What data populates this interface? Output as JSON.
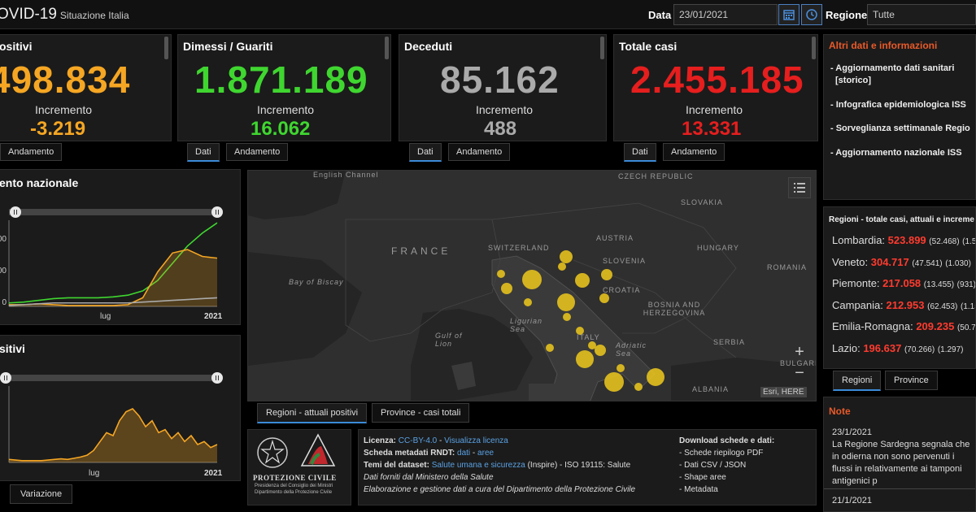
{
  "header": {
    "title": "OVID-19",
    "subtitle": "Situazione Italia",
    "data_label": "Data",
    "data_value": "23/01/2021",
    "regione_label": "Regione",
    "regione_value": "Tutte"
  },
  "colors": {
    "yellow": "#f5a623",
    "green": "#3fd630",
    "gray": "#aaaaaa",
    "red": "#e61e1e",
    "accent": "#3b8bd9"
  },
  "cards": [
    {
      "title": "ositivi",
      "value": "498.834",
      "inc_label": "Incremento",
      "inc_value": "-3.219",
      "tabs": [
        "Andamento"
      ]
    },
    {
      "title": "Dimessi / Guariti",
      "value": "1.871.189",
      "inc_label": "Incremento",
      "inc_value": "16.062",
      "tabs": [
        "Dati",
        "Andamento"
      ]
    },
    {
      "title": "Deceduti",
      "value": "85.162",
      "inc_label": "Incremento",
      "inc_value": "488",
      "tabs": [
        "Dati",
        "Andamento"
      ]
    },
    {
      "title": "Totale casi",
      "value": "2.455.185",
      "inc_label": "Incremento",
      "inc_value": "13.331",
      "tabs": [
        "Dati",
        "Andamento"
      ]
    }
  ],
  "info": {
    "title": "Altri dati e informazioni",
    "items": [
      "- Aggiornamento dati sanitari",
      "[storico]",
      "- Infografica epidemiologica ISS",
      "- Sorveglianza settimanale Regio",
      "- Aggiornamento nazionale ISS"
    ]
  },
  "chart1": {
    "title": "ento nazionale",
    "tick_y": [
      "00",
      "00",
      "0"
    ],
    "tick_x": [
      "lug",
      "2021"
    ]
  },
  "chart2": {
    "title": "sitivi",
    "tick_x": [
      "lug",
      "2021"
    ],
    "tab": "Variazione"
  },
  "chart_data": [
    {
      "type": "line",
      "title": "ento nazionale",
      "x": [
        "lug",
        "2021"
      ],
      "series": [
        {
          "name": "Dimessi / Guariti",
          "color": "#3fd630",
          "values": [
            0.04,
            0.05,
            0.07,
            0.09,
            0.1,
            0.1,
            0.1,
            0.11,
            0.13,
            0.18,
            0.3,
            0.5,
            0.7,
            0.85,
            0.97
          ]
        },
        {
          "name": "Totale positivi",
          "color": "#f5a623",
          "values": [
            0.02,
            0.02,
            0.03,
            0.02,
            0.01,
            0.01,
            0.01,
            0.01,
            0.02,
            0.1,
            0.4,
            0.62,
            0.66,
            0.58,
            0.56
          ]
        },
        {
          "name": "Deceduti",
          "color": "#aaaaaa",
          "values": [
            0.01,
            0.02,
            0.03,
            0.04,
            0.04,
            0.04,
            0.04,
            0.04,
            0.04,
            0.05,
            0.06,
            0.07,
            0.08,
            0.09,
            0.1
          ]
        }
      ]
    },
    {
      "type": "area",
      "title": "sitivi",
      "x": [
        "lug",
        "2021"
      ],
      "series": [
        {
          "name": "Variazione",
          "color": "#f5a623",
          "values": [
            0.05,
            0.04,
            0.03,
            0.03,
            0.03,
            0.03,
            0.04,
            0.05,
            0.06,
            0.05,
            0.07,
            0.09,
            0.12,
            0.2,
            0.35,
            0.5,
            0.45,
            0.7,
            0.85,
            0.9,
            0.78,
            0.6,
            0.7,
            0.5,
            0.55,
            0.4,
            0.5,
            0.35,
            0.45,
            0.3,
            0.35,
            0.25,
            0.3
          ]
        }
      ]
    }
  ],
  "map": {
    "tabs": [
      "Regioni - attuali positivi",
      "Province - casi totali"
    ],
    "labels": [
      "English Channel",
      "FRANCE",
      "SWITZERLAND",
      "AUSTRIA",
      "SLOVENIA",
      "CROATIA",
      "CZECH REPUBLIC",
      "SLOVAKIA",
      "HUNGARY",
      "ROMANIA",
      "BOSNIA AND HERZEGOVINA",
      "SERBIA",
      "BULGARI",
      "ALBANIA",
      "ITALY",
      "Bay of Biscay",
      "Ligurian Sea",
      "Adriatic Sea",
      "Gulf of Lion"
    ],
    "credit": "Esri, HERE"
  },
  "regions": {
    "title": "Regioni - totale casi, attuali e increme",
    "rows": [
      {
        "name": "Lombardia:",
        "val": "523.899",
        "a": "(52.468)",
        "b": "(1.53"
      },
      {
        "name": "Veneto:",
        "val": "304.717",
        "a": "(47.541)",
        "b": "(1.030)"
      },
      {
        "name": "Piemonte:",
        "val": "217.058",
        "a": "(13.455)",
        "b": "(931)"
      },
      {
        "name": "Campania:",
        "val": "212.953",
        "a": "(62.453)",
        "b": "(1.15"
      },
      {
        "name": "Emilia-Romagna:",
        "val": "209.235",
        "a": "(50.73",
        "b": ""
      },
      {
        "name": "Lazio:",
        "val": "196.637",
        "a": "(70.266)",
        "b": "(1.297)"
      }
    ],
    "tabs": [
      "Regioni",
      "Province"
    ]
  },
  "notes": {
    "title": "Note",
    "date1": "23/1/2021",
    "text1": "La Regione Sardegna segnala che in odierna non sono pervenuti i flussi in relativamente ai tamponi antigenici p",
    "date2": "21/1/2021"
  },
  "footer": {
    "logo_text": "PROTEZIONE CIVILE",
    "logo_sub1": "Presidenza del Consiglio dei Ministri",
    "logo_sub2": "Dipartimento della Protezione Civile",
    "licenza_label": "Licenza:",
    "licenza_link": "CC-BY-4.0",
    "visualizza": "Visualizza licenza",
    "scheda_label": "Scheda metadati RNDT:",
    "scheda_dati": "dati",
    "scheda_aree": "aree",
    "temi_label": "Temi del dataset:",
    "temi_link": "Salute umana e sicurezza",
    "temi_rest": "(Inspire) - ISO 19115: Salute",
    "forniti": "Dati forniti dal Ministero della Salute",
    "elaborazione": "Elaborazione e gestione dati a cura del Dipartimento della Protezione Civile",
    "download_title": "Download schede e dati:",
    "downloads": [
      "- Schede riepilogo PDF",
      "- Dati CSV / JSON",
      "- Shape aree",
      "- Metadata"
    ]
  }
}
